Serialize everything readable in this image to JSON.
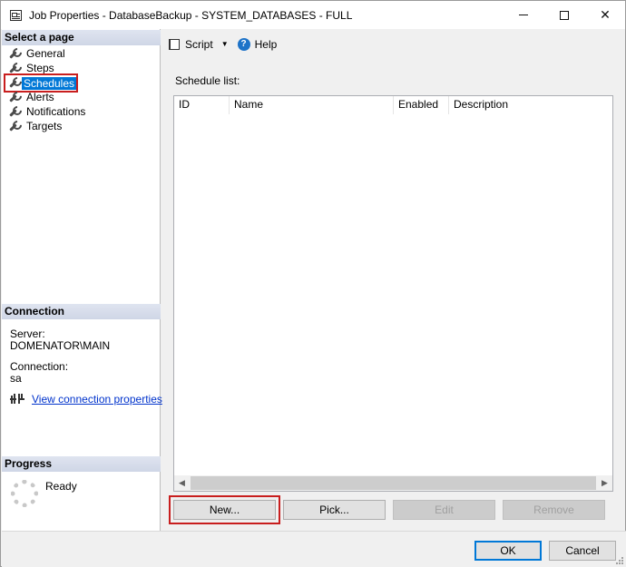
{
  "window": {
    "title": "Job Properties - DatabaseBackup - SYSTEM_DATABASES - FULL"
  },
  "left": {
    "select_page_header": "Select a page",
    "pages": [
      {
        "label": "General",
        "selected": false
      },
      {
        "label": "Steps",
        "selected": false
      },
      {
        "label": "Schedules",
        "selected": true
      },
      {
        "label": "Alerts",
        "selected": false
      },
      {
        "label": "Notifications",
        "selected": false
      },
      {
        "label": "Targets",
        "selected": false
      }
    ],
    "connection_header": "Connection",
    "server_label": "Server:",
    "server_value": "DOMENATOR\\MAIN",
    "connection_label": "Connection:",
    "connection_value": "sa",
    "view_connection_link": "View connection properties",
    "progress_header": "Progress",
    "progress_status": "Ready"
  },
  "toolbar": {
    "script_label": "Script",
    "help_label": "Help"
  },
  "main": {
    "schedule_list_label": "Schedule list:",
    "columns": [
      "ID",
      "Name",
      "Enabled",
      "Description"
    ],
    "rows": []
  },
  "buttons": {
    "new": "New...",
    "pick": "Pick...",
    "edit": "Edit",
    "remove": "Remove",
    "ok": "OK",
    "cancel": "Cancel"
  },
  "colors": {
    "selection": "#0078d7",
    "highlight_border": "#c81e1e",
    "link": "#0033cc"
  }
}
